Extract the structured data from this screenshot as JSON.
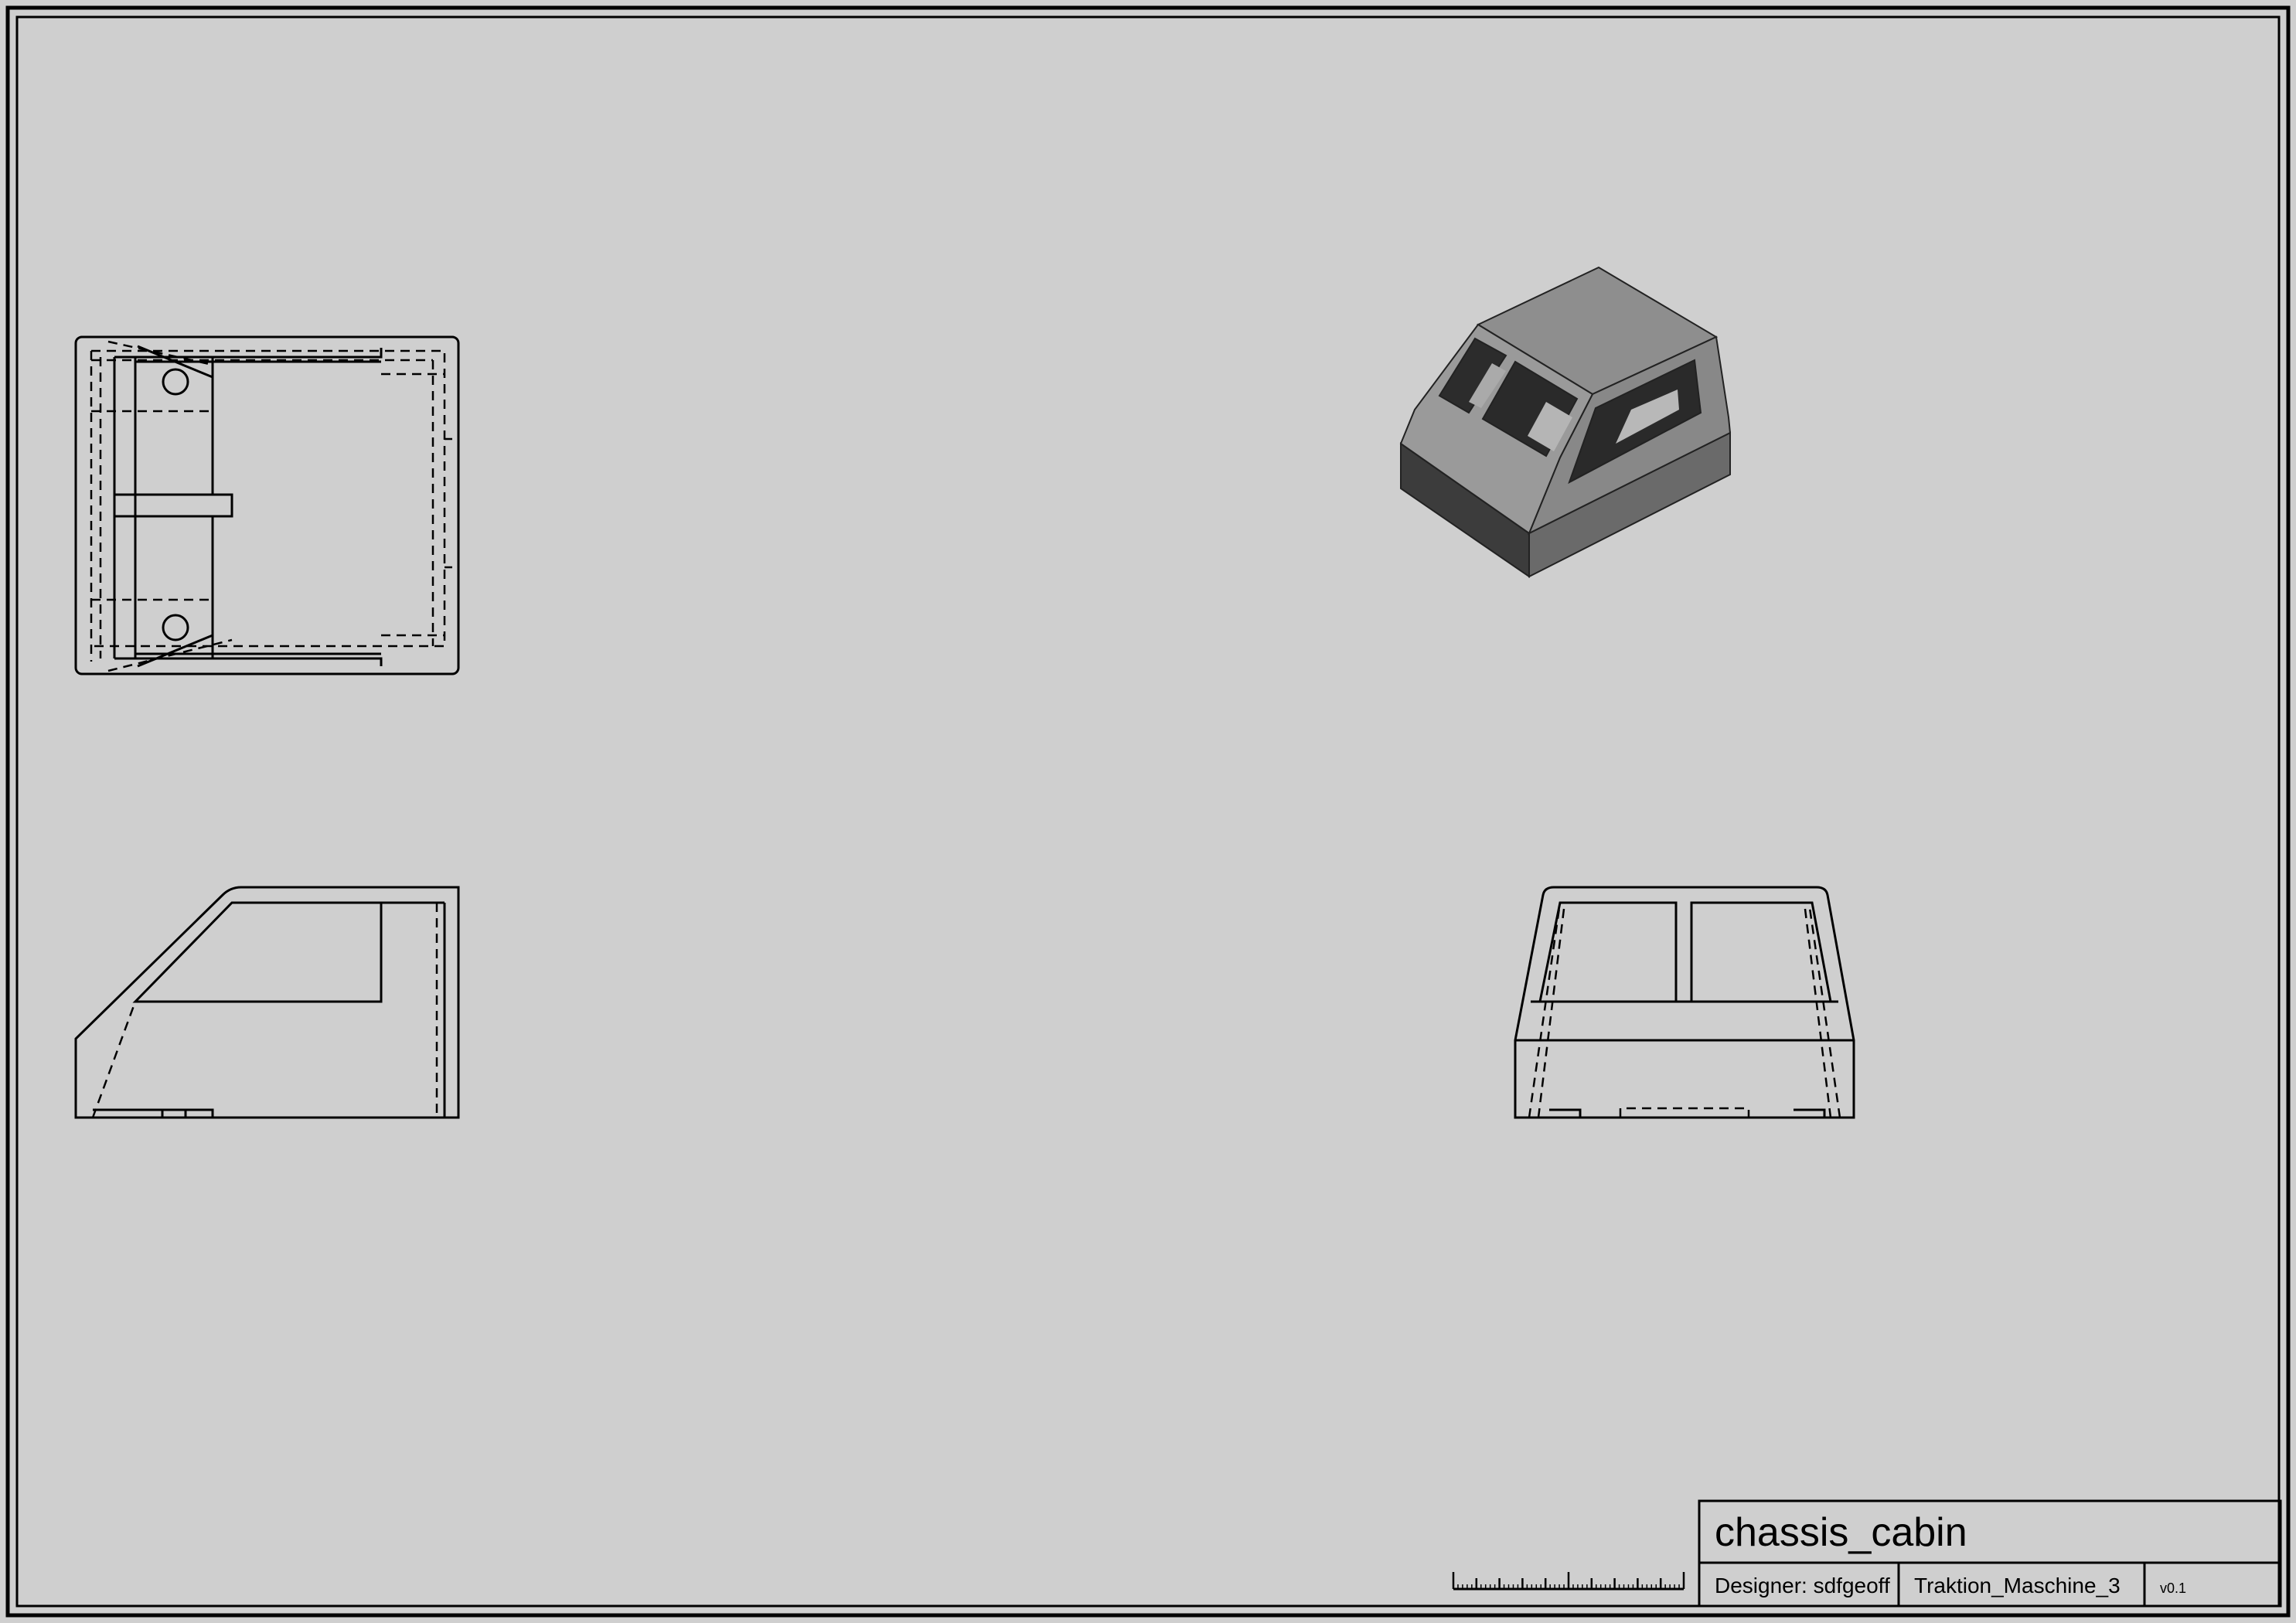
{
  "title_block": {
    "part_name": "chassis_cabin",
    "designer": "Designer: sdfgeoff",
    "project": "Traktion_Maschine_3",
    "version": "v0.1"
  },
  "colors": {
    "paper": "#cfcfcf",
    "line": "#000000",
    "iso_top": "#8c8c8c",
    "iso_front": "#7a7a7a",
    "iso_side": "#3c3c3c",
    "iso_inner": "#2a2a2a"
  },
  "views": [
    "top-view",
    "side-view",
    "front-view",
    "isometric-view"
  ],
  "scale_bar": {
    "divisions": 10
  }
}
